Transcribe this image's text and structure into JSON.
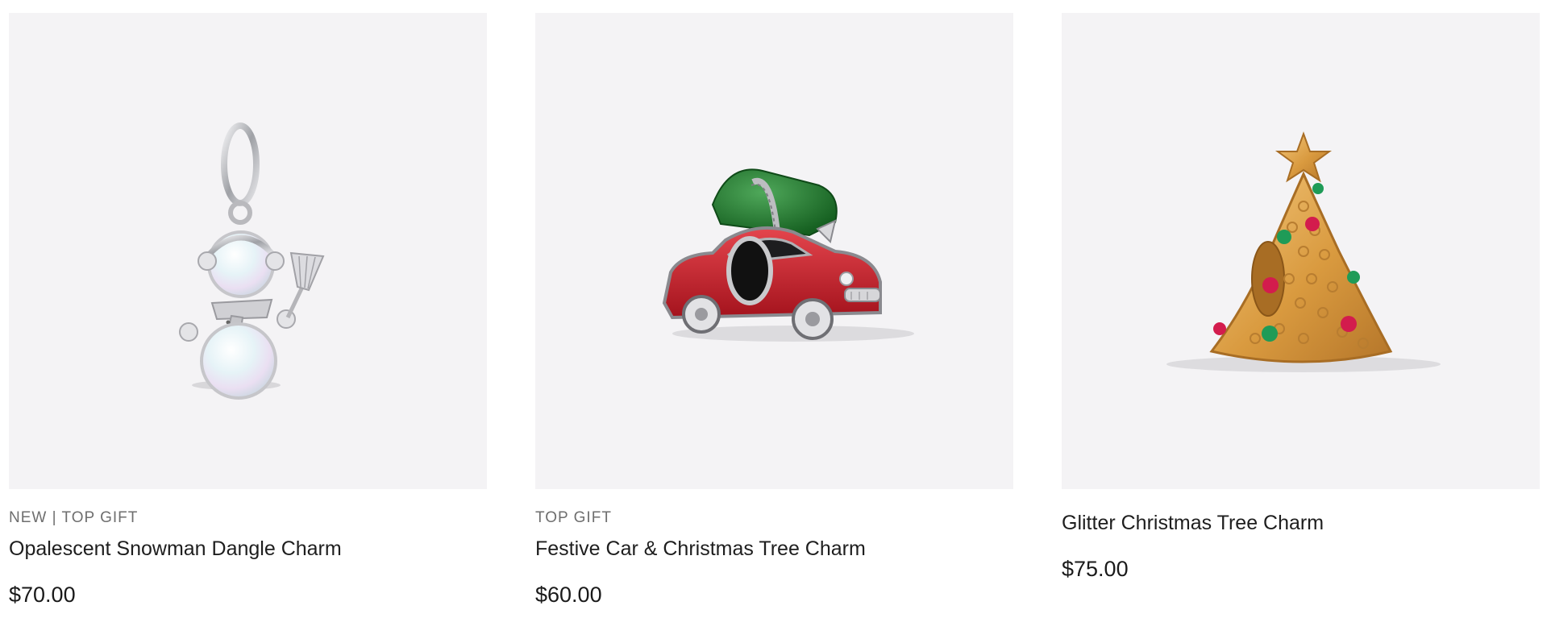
{
  "products": [
    {
      "image_alt": "snowman-charm-image",
      "badge": "NEW | TOP GIFT",
      "name": "Opalescent Snowman Dangle Charm",
      "price": "$70.00"
    },
    {
      "image_alt": "car-charm-image",
      "badge": "TOP GIFT",
      "name": "Festive Car & Christmas Tree Charm",
      "price": "$60.00"
    },
    {
      "image_alt": "tree-charm-image",
      "badge": "",
      "name": "Glitter Christmas Tree Charm",
      "price": "$75.00"
    }
  ],
  "colors": {
    "tile_background": "#f4f3f5",
    "badge_text": "#6e6e6e",
    "silver": "#c9c9cc",
    "enamel_red": "#c8202c",
    "enamel_green": "#1f7a2a",
    "gold": "#d9a04a"
  }
}
